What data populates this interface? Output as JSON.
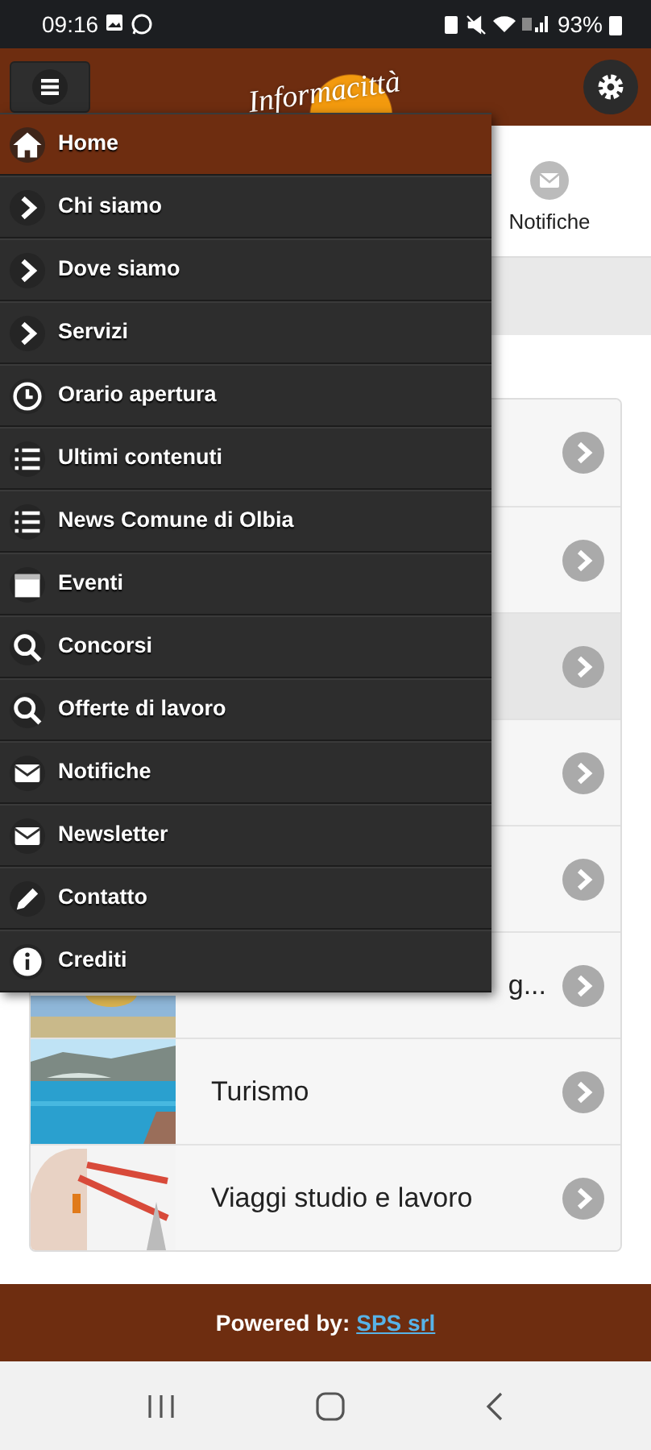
{
  "status_bar": {
    "time": "09:16",
    "battery": "93%"
  },
  "header": {
    "logo": "Informacittà"
  },
  "tabs": [
    {
      "label": "Notifiche",
      "selected": false
    }
  ],
  "list": [
    {
      "selected": false
    },
    {
      "selected": false
    },
    {
      "selected": true
    },
    {
      "selected": false
    },
    {
      "selected": false
    },
    {
      "title": "g...",
      "selected": false
    },
    {
      "title": "Turismo",
      "selected": false
    },
    {
      "title": "Viaggi studio e lavoro",
      "selected": false
    }
  ],
  "menu": [
    {
      "label": "Home",
      "kind": "home",
      "selected": true
    },
    {
      "label": "Chi siamo",
      "kind": "chevron",
      "selected": false
    },
    {
      "label": "Dove siamo",
      "kind": "chevron",
      "selected": false
    },
    {
      "label": "Servizi",
      "kind": "chevron",
      "selected": false
    },
    {
      "label": "Orario apertura",
      "kind": "clock",
      "selected": false
    },
    {
      "label": "Ultimi contenuti",
      "kind": "list",
      "selected": false
    },
    {
      "label": "News Comune di Olbia",
      "kind": "list",
      "selected": false
    },
    {
      "label": "Eventi",
      "kind": "calendar",
      "selected": false
    },
    {
      "label": "Concorsi",
      "kind": "search",
      "selected": false
    },
    {
      "label": "Offerte di lavoro",
      "kind": "search",
      "selected": false
    },
    {
      "label": "Notifiche",
      "kind": "mail",
      "selected": false
    },
    {
      "label": "Newsletter",
      "kind": "mail",
      "selected": false
    },
    {
      "label": "Contatto",
      "kind": "pencil",
      "selected": false
    },
    {
      "label": "Crediti",
      "kind": "info",
      "selected": false
    }
  ],
  "footer": {
    "label": "Powered by:",
    "link": "SPS srl"
  }
}
